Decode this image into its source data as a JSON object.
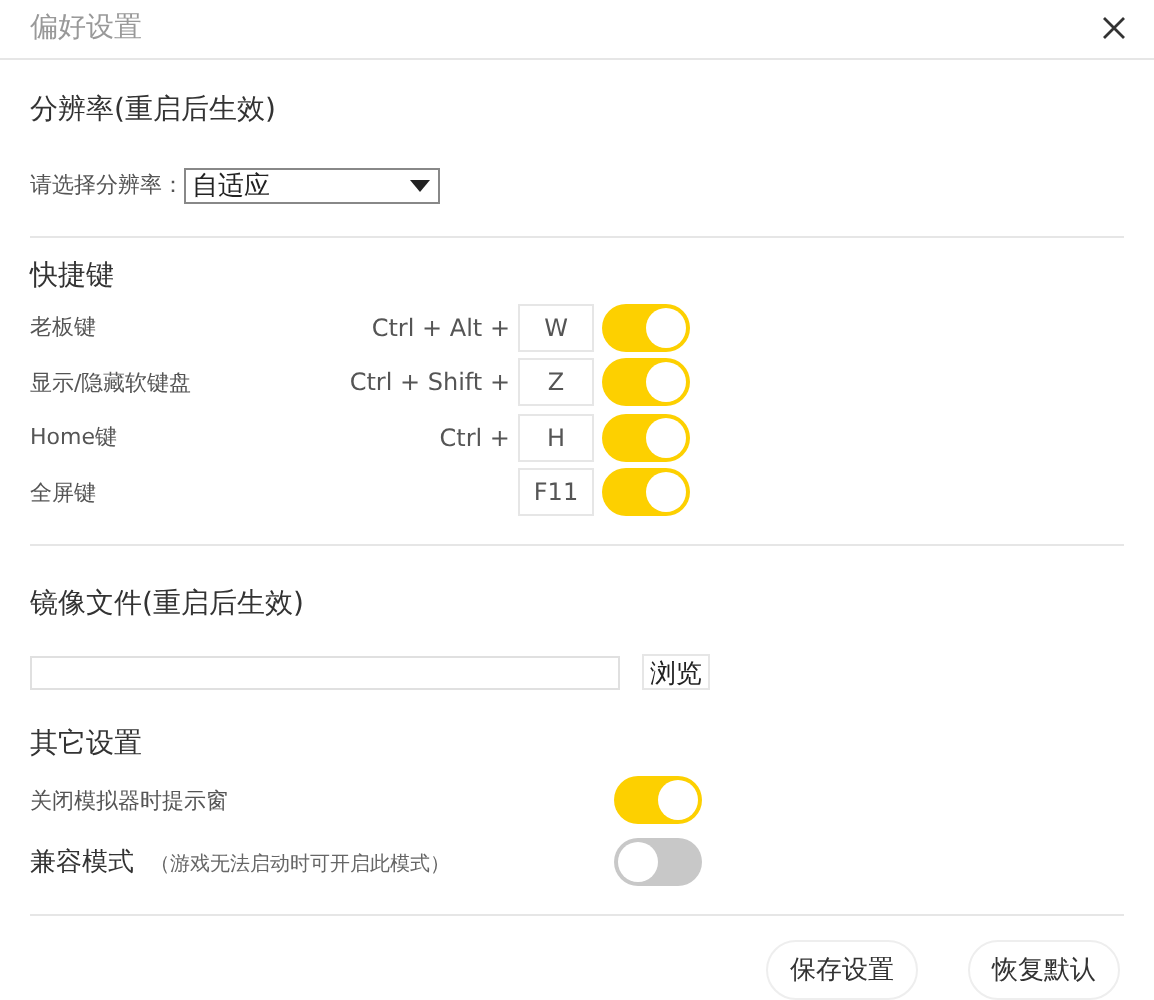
{
  "window": {
    "title": "偏好设置"
  },
  "resolution": {
    "heading": "分辨率(重启后生效)",
    "label": "请选择分辨率：",
    "value": "自适应"
  },
  "shortcuts": {
    "heading": "快捷键",
    "rows": [
      {
        "label": "老板键",
        "modifiers": "Ctrl + Alt +",
        "key": "W",
        "on": true
      },
      {
        "label": "显示/隐藏软键盘",
        "modifiers": "Ctrl + Shift +",
        "key": "Z",
        "on": true
      },
      {
        "label": "Home键",
        "modifiers": "Ctrl +",
        "key": "H",
        "on": true
      },
      {
        "label": "全屏键",
        "key": "F11",
        "on": true
      }
    ]
  },
  "image_file": {
    "heading": "镜像文件(重启后生效)",
    "browse": "浏览"
  },
  "other": {
    "heading": "其它设置",
    "rows": [
      {
        "kind": "plain",
        "label": "关闭模拟器时提示窗",
        "on": true
      },
      {
        "kind": "titled",
        "label": "兼容模式",
        "note": "（游戏无法启动时可开启此模式）",
        "on": false
      }
    ]
  },
  "buttons": [
    "保存设置",
    "恢复默认"
  ]
}
